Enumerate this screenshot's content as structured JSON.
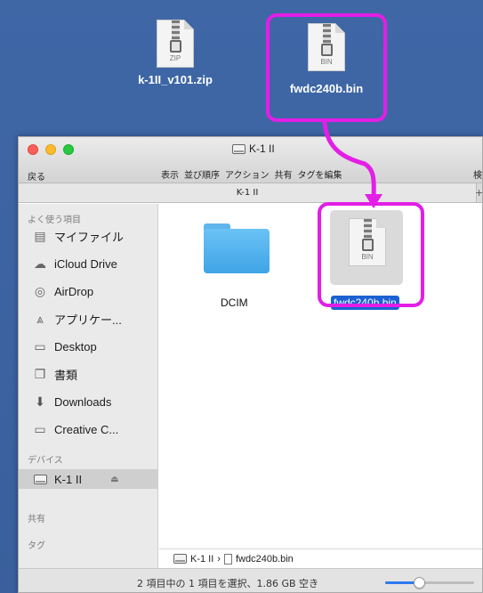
{
  "desktop": {
    "items": [
      {
        "name": "k-1II_v101.zip",
        "ext": "ZIP"
      },
      {
        "name": "fwdc240b.bin",
        "ext": "BIN"
      }
    ]
  },
  "window": {
    "title": "K-1 II",
    "toolbar": {
      "back": "戻る",
      "view": "表示",
      "sort": "並び順序",
      "action": "アクション",
      "share": "共有",
      "tags": "タグを編集",
      "search": "検"
    },
    "tab": "K-1 II",
    "tab_plus": "+"
  },
  "sidebar": {
    "favorites_heading": "よく使う項目",
    "favorites": [
      {
        "label": "マイファイル",
        "icon": "all-files-icon"
      },
      {
        "label": "iCloud Drive",
        "icon": "cloud-icon"
      },
      {
        "label": "AirDrop",
        "icon": "airdrop-icon"
      },
      {
        "label": "アプリケー...",
        "icon": "applications-icon"
      },
      {
        "label": "Desktop",
        "icon": "desktop-icon"
      },
      {
        "label": "書類",
        "icon": "documents-icon"
      },
      {
        "label": "Downloads",
        "icon": "downloads-icon"
      },
      {
        "label": "Creative C...",
        "icon": "folder-icon"
      }
    ],
    "devices_heading": "デバイス",
    "device": {
      "label": "K-1 II",
      "eject": "⏏"
    },
    "shared_heading": "共有",
    "tags_heading": "タグ"
  },
  "main": {
    "items": [
      {
        "name": "DCIM",
        "type": "folder"
      },
      {
        "name": "fwdc240b.bin",
        "type": "file",
        "ext": "BIN",
        "selected": true
      }
    ]
  },
  "pathbar": {
    "volume": "K-1 II",
    "separator": "›",
    "file": "fwdc240b.bin"
  },
  "status": {
    "text": "2 項目中の 1 項目を選択、1.86 GB 空き",
    "icon_zoom": 0.38
  },
  "colors": {
    "highlight": "#e31ee6",
    "selection": "#1b61d1",
    "folder": "#4fb0ee"
  }
}
